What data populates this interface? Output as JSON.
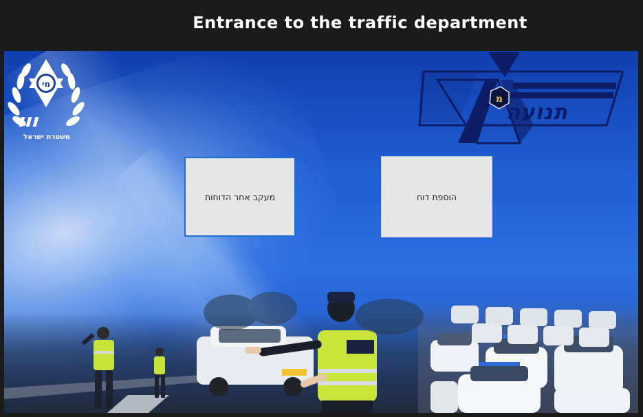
{
  "window": {
    "title": "Entrance to the traffic department"
  },
  "logos": {
    "police_caption": "משטרת ישראל",
    "traffic_logo_text": "תנועה",
    "traffic_badge_letter": "מ",
    "police_badge_letters": "מי"
  },
  "buttons": {
    "track_reports": "מעקב אחר הדוחות",
    "add_report": "הוספת דוח"
  }
}
